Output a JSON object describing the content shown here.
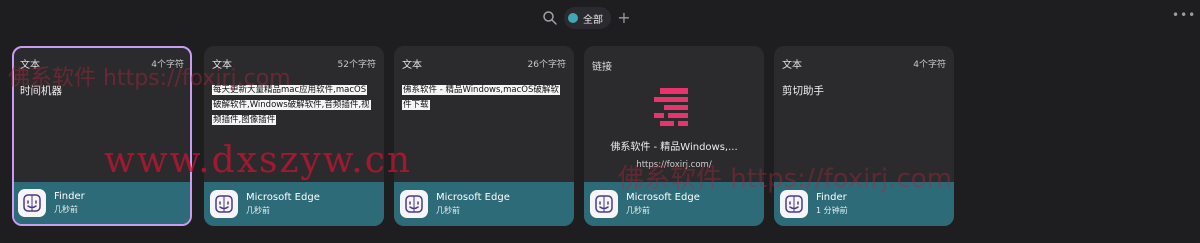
{
  "toolbar": {
    "filter_label": "全部",
    "add_label": "+",
    "more_label": "•••"
  },
  "cards": [
    {
      "type": "文本",
      "count": "4个字符",
      "content": "时间机器",
      "app": "Finder",
      "time": "几秒前"
    },
    {
      "type": "文本",
      "count": "52个字符",
      "content": "每天更新大量精品mac应用软件,macOS破解软件,Windows破解软件,音频插件,视频插件,图像插件",
      "app": "Microsoft Edge",
      "time": "几秒前"
    },
    {
      "type": "文本",
      "count": "26个字符",
      "content": "佛系软件 - 精品Windows,macOS破解软件下载",
      "app": "Microsoft Edge",
      "time": "几秒前"
    },
    {
      "type": "链接",
      "link_title": "佛系软件 - 精品Windows,...",
      "link_url": "https://foxirj.com/",
      "app": "Microsoft Edge",
      "time": "几秒前"
    },
    {
      "type": "文本",
      "count": "4个字符",
      "content": "剪切助手",
      "app": "Finder",
      "time": "1 分钟前"
    }
  ],
  "watermarks": {
    "top": "佛系软件 https://foxirj.com",
    "main": "www.dxszyw.cn",
    "bottom": "佛系软件 https://foxirj.com"
  },
  "colors": {
    "background": "#1e1e21",
    "card": "#2b2b2e",
    "card_footer": "#2d6b78",
    "selected_border": "#c89df0",
    "filter_dot": "#3ea8b4",
    "link_logo": "#e8336d"
  }
}
